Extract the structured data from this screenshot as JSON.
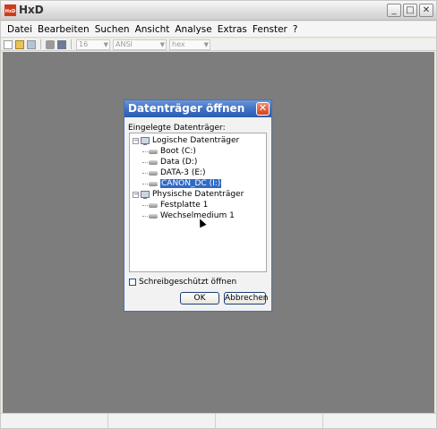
{
  "app": {
    "title": "HxD",
    "icon_text": "HxD"
  },
  "window_controls": {
    "minimize": "_",
    "maximize": "□",
    "close": "✕"
  },
  "menu": [
    "Datei",
    "Bearbeiten",
    "Suchen",
    "Ansicht",
    "Analyse",
    "Extras",
    "Fenster",
    "?"
  ],
  "toolbar": {
    "bytes_per_row": "16",
    "charset": "ANSI",
    "offset_base": "hex"
  },
  "dialog": {
    "title": "Datenträger öffnen",
    "close_glyph": "✕",
    "group_label": "Eingelegte Datenträger:",
    "tree": {
      "logical": {
        "label": "Logische Datenträger",
        "items": [
          "Boot (C:)",
          "Data (D:)",
          "DATA-3 (E:)",
          "CANON_DC (I:)"
        ],
        "selected_index": 3
      },
      "physical": {
        "label": "Physische Datenträger",
        "items": [
          "Festplatte 1",
          "Wechselmedium 1"
        ]
      }
    },
    "checkbox_label": "Schreibgeschützt öffnen",
    "checkbox_checked": false,
    "ok_label": "OK",
    "cancel_label": "Abbrechen"
  }
}
